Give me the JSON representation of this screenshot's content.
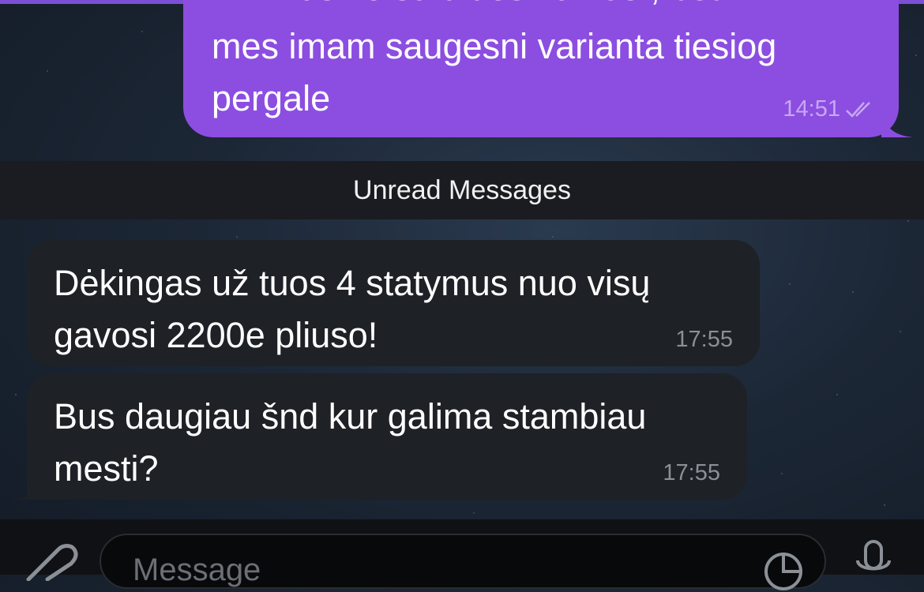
{
  "outgoing": {
    "cut_line": "ir minusine su didesniu koef, bet",
    "text": "mes imam saugesni varianta tiesiog pergale",
    "time": "14:51"
  },
  "divider": {
    "label": "Unread Messages"
  },
  "incoming": [
    {
      "text": "Dėkingas už tuos 4 statymus nuo visų gavosi 2200e pliuso!",
      "time": "17:55"
    },
    {
      "text": "Bus daugiau šnd kur galima stambiau mesti?",
      "time": "17:55"
    }
  ],
  "composer": {
    "placeholder": "Message"
  },
  "colors": {
    "outgoing_bubble": "#8c4ee0",
    "incoming_bubble": "#1e2126",
    "divider_bg": "#1b1c21"
  }
}
